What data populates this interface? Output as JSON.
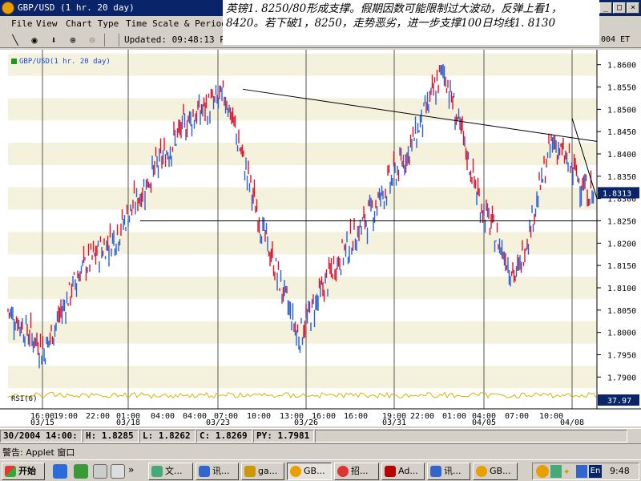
{
  "window": {
    "title": "GBP/USD (1 hr.  20 day)",
    "controls": [
      "_",
      "□",
      "×"
    ]
  },
  "menu": {
    "items": [
      "File",
      "View",
      "Chart Type",
      "Time Scale & Period"
    ]
  },
  "toolbar": {
    "tools": [
      "draw-line",
      "select-point",
      "download",
      "zoom-in",
      "zoom-out"
    ],
    "updated": "Updated: 09:48:13 PM"
  },
  "overlay": {
    "text": "英镑1. 8250/80形成支撑。假期因数可能限制过大波动，反弹上看1，8420。若下破1，8250，走势恶劣，进一步支撑100日均线1. 8130"
  },
  "et_label": "004 ET",
  "chart": {
    "legend": "GBP/USD(1 hr.  20 day)",
    "rsi_label": "RSI(6)",
    "rsi_value": "37.97",
    "last_price": "1.8313",
    "y_ticks": [
      "1.8600",
      "1.8550",
      "1.8500",
      "1.8450",
      "1.8400",
      "1.8350",
      "1.8300",
      "1.8250",
      "1.8200",
      "1.8150",
      "1.8100",
      "1.8050",
      "1.8000",
      "1.7950",
      "1.7900"
    ],
    "x_time_labels": [
      "16:00",
      "19:00",
      "22:00",
      "01:00",
      "04:00",
      "04:00",
      "07:00",
      "10:00",
      "13:00",
      "16:00",
      "16:00",
      "19:00",
      "22:00",
      "01:00",
      "04:00",
      "07:00",
      "10:00"
    ],
    "x_date_labels": [
      "03/15",
      "03/18",
      "03/23",
      "03/26",
      "03/31",
      "04/05",
      "04/08"
    ]
  },
  "chart_data": {
    "type": "line",
    "title": "GBP/USD(1 hr.  20 day)",
    "xlabel": "",
    "ylabel": "",
    "ylim": [
      1.787,
      1.863
    ],
    "y_ticks": [
      1.86,
      1.855,
      1.85,
      1.845,
      1.84,
      1.835,
      1.83,
      1.825,
      1.82,
      1.815,
      1.81,
      1.805,
      1.8,
      1.795,
      1.79
    ],
    "x": [
      "03/15 16:00",
      "03/15 19:00",
      "03/15 22:00",
      "03/18 01:00",
      "03/18 04:00",
      "03/23 04:00",
      "03/23 07:00",
      "03/23 10:00",
      "03/26 13:00",
      "03/26 16:00",
      "03/31 16:00",
      "03/31 19:00",
      "03/31 22:00",
      "04/05 01:00",
      "04/05 04:00",
      "04/05 07:00",
      "04/08 10:00"
    ],
    "series": [
      {
        "values": [
          1.805,
          1.796,
          1.814,
          1.822,
          1.836,
          1.848,
          1.853,
          1.823,
          1.799,
          1.815,
          1.827,
          1.84,
          1.859,
          1.829,
          1.812,
          1.843,
          1.8313
        ]
      }
    ],
    "last_price": 1.8313,
    "rsi_value": 37.97,
    "grid": true
  },
  "status": {
    "datetime": "30/2004 14:00:",
    "high": "H: 1.8285",
    "low": "L: 1.8262",
    "close": "C: 1.8269",
    "prev": "PY: 1.7981"
  },
  "warning": "警告: Applet 窗口",
  "taskbar": {
    "start": "开始",
    "buttons": [
      "文...",
      "讯...",
      "ga...",
      "GB...",
      "招...",
      "Ad...",
      "讯...",
      "GB..."
    ],
    "tray_lang": "En",
    "clock": "9:48"
  },
  "colors": {
    "up": "#2a5fd6",
    "down": "#e0102a",
    "band": "#f4f2dc",
    "rsi": "#d8b400",
    "titlebar": "#0a246a"
  }
}
